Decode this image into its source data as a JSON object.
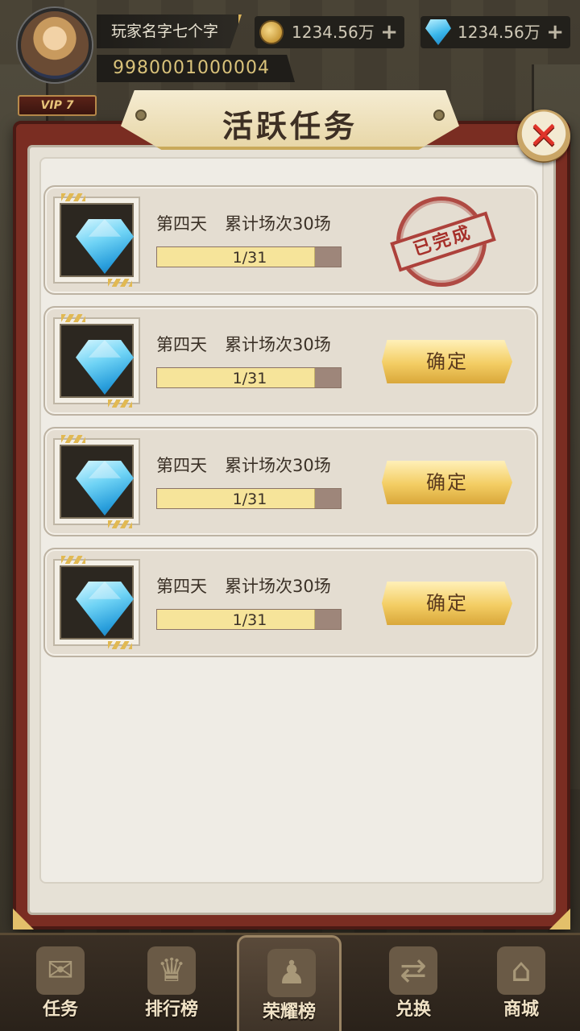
{
  "player": {
    "name": "玩家名字七个字",
    "id": "9980001000004",
    "vip": "VIP 7"
  },
  "currency": {
    "coins": "1234.56万",
    "gems": "1234.56万",
    "add_symbol": "+"
  },
  "dialog": {
    "title": "活跃任务",
    "close_symbol": "✕"
  },
  "tasks": [
    {
      "day": "第四天",
      "requirement": "累计场次30场",
      "progress_text": "1/31",
      "state": "completed",
      "stamp": "已完成"
    },
    {
      "day": "第四天",
      "requirement": "累计场次30场",
      "progress_text": "1/31",
      "state": "claim",
      "button": "确定"
    },
    {
      "day": "第四天",
      "requirement": "累计场次30场",
      "progress_text": "1/31",
      "state": "claim",
      "button": "确定"
    },
    {
      "day": "第四天",
      "requirement": "累计场次30场",
      "progress_text": "1/31",
      "state": "claim",
      "button": "确定"
    }
  ],
  "nav": {
    "items": [
      {
        "label": "任务",
        "icon": "scroll-icon"
      },
      {
        "label": "排行榜",
        "icon": "trophy-icon"
      },
      {
        "label": "荣耀榜",
        "icon": "people-icon",
        "active": true
      },
      {
        "label": "兑换",
        "icon": "exchange-icon"
      },
      {
        "label": "商城",
        "icon": "shop-icon"
      }
    ]
  },
  "colors": {
    "panel_frame": "#7a2d22",
    "confirm_button": "#f3cd63",
    "progress_fill": "#f6e49a",
    "stamp": "#a6302a",
    "gem": "#39b6ea"
  }
}
